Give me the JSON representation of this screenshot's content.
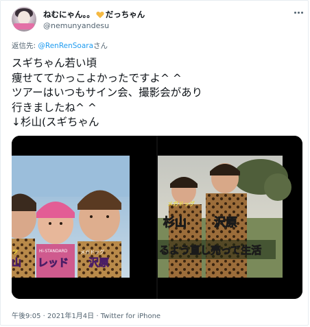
{
  "author": {
    "display_name_prefix": "ねむにゃん。。",
    "display_name_suffix": "だっちゃん",
    "handle": "@nemunyandesu"
  },
  "reply": {
    "prefix": "返信先: ",
    "mention": "@RenRenSoara",
    "suffix": "さん"
  },
  "tweet": {
    "lines": [
      "スギちゃん若い頃",
      "痩せててかっこよかったですよ^ ^",
      "ツアーはいつもサイン会、撮影会があり",
      "行きましたね^ ^",
      "↓杉山(スギちゃん"
    ]
  },
  "media": {
    "left_captions": [
      "ッ",
      "山",
      "Hi-STANDARD",
      "レッド",
      "メガドッグ",
      "沢原"
    ],
    "right_captions": [
      "メガドッグ",
      "杉山",
      "沢原",
      "るよう直し売って生活"
    ]
  },
  "meta": {
    "timestamp": "午後9:05 · 2021年1月4日 · Twitter for iPhone"
  },
  "icons": [
    "avatar",
    "heart-emoji-icon",
    "more-icon"
  ],
  "colors": {
    "link": "#1d9bf0",
    "secondary": "#536471",
    "heart": "#f5b942"
  }
}
